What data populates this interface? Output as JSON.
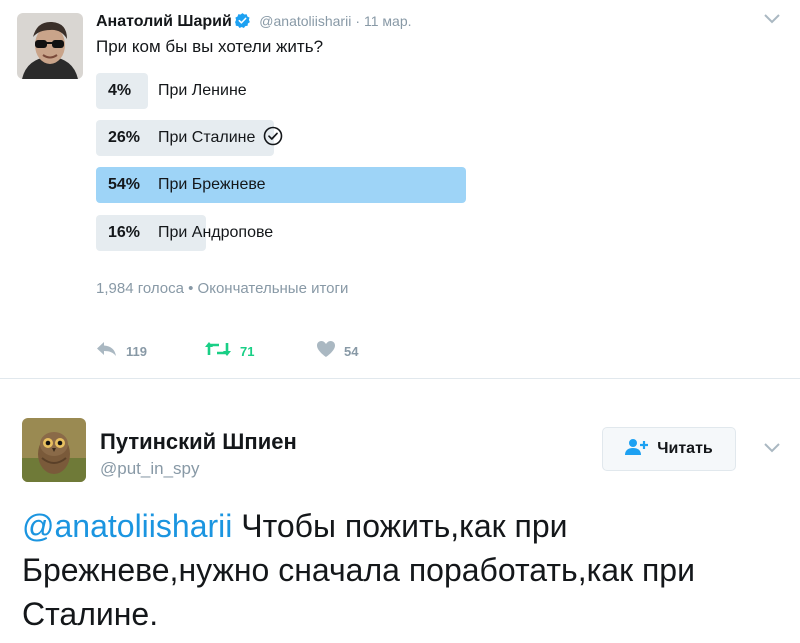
{
  "tweet1": {
    "author_name": "Анатолий Шарий",
    "handle": "@anatoliisharii",
    "separator": "·",
    "date": "11 мар.",
    "question": "При ком бы вы хотели жить?",
    "poll": [
      {
        "percent": "4%",
        "value": 4,
        "label": "При Ленине",
        "winner": false,
        "voted": false
      },
      {
        "percent": "26%",
        "value": 26,
        "label": "При Сталине",
        "winner": false,
        "voted": true
      },
      {
        "percent": "54%",
        "value": 54,
        "label": "При Брежневе",
        "winner": true,
        "voted": false
      },
      {
        "percent": "16%",
        "value": 16,
        "label": "При Андропове",
        "winner": false,
        "voted": false
      }
    ],
    "poll_meta": "1,984 голоса • Окончательные итоги",
    "actions": {
      "reply_count": "119",
      "retweet_count": "71",
      "like_count": "54"
    }
  },
  "tweet2": {
    "author_name": "Путинский Шпиен",
    "handle": "@put_in_spy",
    "follow_label": "Читать",
    "mention": "@anatoliisharii",
    "text": " Чтобы пожить,как при Брежневе,нужно сначала поработать,как при Сталине."
  },
  "colors": {
    "accent": "#1b95e0",
    "poll_bar": "#e6ecf0",
    "poll_winner": "#9ed4f7",
    "retweet_green": "#19cf86",
    "muted": "#8899a6"
  }
}
